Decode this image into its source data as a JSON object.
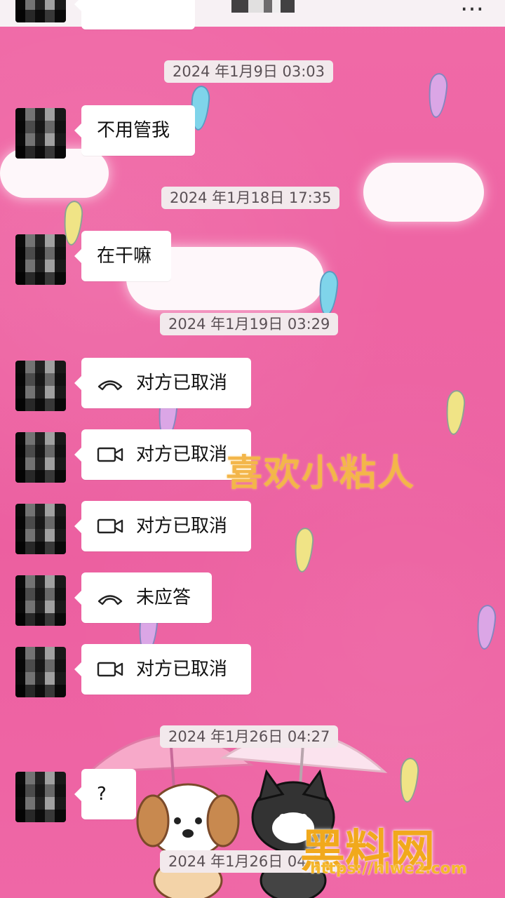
{
  "header": {
    "back_icon": "back-arrow-icon",
    "more_icon": "more-options-icon"
  },
  "overlay_text": "喜欢小粘人",
  "watermark": {
    "logo": "黑料网",
    "url": "https://hlwe2.com"
  },
  "colors": {
    "background": "#ee64a4",
    "bubble": "#ffffff",
    "timestamp_bg": "#f2e9ec",
    "watermark": "#f1a91c"
  },
  "messages": [
    {
      "timestamp": "2024 年1月9日 03:03",
      "text": "不用管我",
      "icon": ""
    },
    {
      "timestamp": "2024 年1月18日 17:35",
      "text": "在干嘛",
      "icon": ""
    },
    {
      "timestamp": "2024 年1月19日 03:29",
      "text": "对方已取消",
      "icon": "phone-icon"
    },
    {
      "timestamp": "",
      "text": "对方已取消",
      "icon": "video-camera-icon"
    },
    {
      "timestamp": "",
      "text": "对方已取消",
      "icon": "video-camera-icon"
    },
    {
      "timestamp": "",
      "text": "未应答",
      "icon": "phone-icon"
    },
    {
      "timestamp": "",
      "text": "对方已取消",
      "icon": "video-camera-icon"
    },
    {
      "timestamp": "2024 年1月26日 04:27",
      "text": "?",
      "icon": ""
    }
  ],
  "last_timestamp": "2024 年1月26日 04:33"
}
